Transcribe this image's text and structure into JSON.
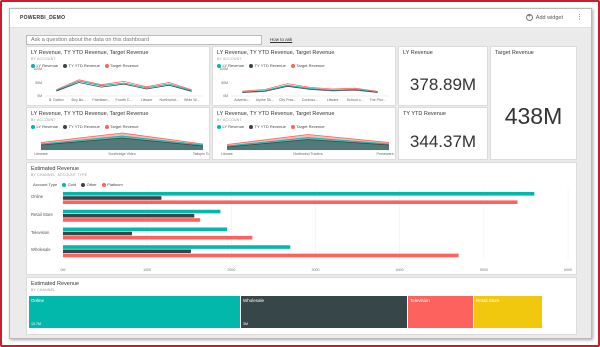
{
  "header": {
    "title": "POWERBI_DEMO",
    "add_widget": "Add widget",
    "more_icon": "more-options-icon"
  },
  "qna": {
    "placeholder": "Ask a question about the data on this dashboard",
    "howto": "How to ask"
  },
  "line_tiles": [
    {
      "title": "LY Revenue, TY YTD Revenue, Target Revenue",
      "subtitle": "BY ACCOUNT",
      "legend": [
        "LY Revenue",
        "TY YTD Revenue",
        "Target Revenue"
      ],
      "yticks": [
        "100M",
        "50M",
        "0M"
      ]
    },
    {
      "title": "LY Revenue, TY YTD Revenue, Target Revenue",
      "subtitle": "BY ACCOUNT",
      "legend": [
        "LY Revenue",
        "TY YTD Revenue",
        "Target Revenue"
      ],
      "yticks": [
        "100M",
        "50M",
        "0M"
      ]
    },
    {
      "title": "LY Revenue, TY YTD Revenue, Target Revenue",
      "subtitle": "BY ACCOUNT",
      "legend": [
        "LY Revenue",
        "TY YTD Revenue",
        "Target Revenue"
      ],
      "yticks": []
    },
    {
      "title": "LY Revenue, TY YTD Revenue, Target Revenue",
      "subtitle": "BY ACCOUNT",
      "legend": [
        "LY Revenue",
        "TY YTD Revenue",
        "Target Revenue"
      ],
      "yticks": []
    }
  ],
  "cards": {
    "ly_revenue": {
      "title": "LY Revenue",
      "value": "378.89M"
    },
    "target_revenue": {
      "title": "Target Revenue",
      "value": "438M"
    },
    "ty_ytd_revenue": {
      "title": "TY YTD Revenue",
      "value": "344.37M"
    }
  },
  "colors": {
    "ly": "#01b8aa",
    "ty": "#374649",
    "target": "#fd625e",
    "platinum": "#fd625e",
    "gold": "#01b8aa",
    "other": "#374649",
    "treemap_online": "#01b8aa",
    "treemap_wholesale": "#374649",
    "treemap_television": "#fd625e",
    "treemap_retail": "#f2c80f"
  },
  "chart_data": [
    {
      "type": "line",
      "categories": [
        "B. Dalton",
        "Buy Bu...",
        "Fabrikam...",
        "Fourth C...",
        "Litware",
        "Northwind...",
        "Wide W..."
      ],
      "series": [
        {
          "name": "LY Revenue",
          "values": [
            20,
            55,
            38,
            48,
            30,
            45,
            20
          ]
        },
        {
          "name": "TY YTD Revenue",
          "values": [
            18,
            50,
            33,
            44,
            26,
            40,
            17
          ]
        },
        {
          "name": "Target Revenue",
          "values": [
            23,
            60,
            42,
            54,
            34,
            50,
            23
          ]
        }
      ],
      "ylim": [
        0,
        100
      ]
    },
    {
      "type": "line",
      "categories": [
        "Adventu...",
        "Alpine Sk...",
        "City Pow...",
        "Contoso...",
        "Litware",
        "School o...",
        "The Pho..."
      ],
      "series": [
        {
          "name": "LY Revenue",
          "values": [
            15,
            20,
            40,
            28,
            22,
            25,
            15
          ]
        },
        {
          "name": "TY YTD Revenue",
          "values": [
            13,
            17,
            36,
            25,
            19,
            22,
            13
          ]
        },
        {
          "name": "Target Revenue",
          "values": [
            18,
            24,
            46,
            32,
            26,
            29,
            17
          ]
        }
      ],
      "ylim": [
        0,
        100
      ]
    },
    {
      "type": "area",
      "categories": [
        "Liteware",
        "Southridge Video",
        "Tailspin Toys"
      ],
      "series": [
        {
          "name": "LY Revenue",
          "values": [
            12,
            28,
            10
          ]
        },
        {
          "name": "TY YTD Revenue",
          "values": [
            10,
            24,
            8
          ]
        },
        {
          "name": "Target Revenue",
          "values": [
            15,
            34,
            12
          ]
        }
      ]
    },
    {
      "type": "area",
      "categories": [
        "Litware",
        "Northwind Traders",
        "Proseware, Inc."
      ],
      "series": [
        {
          "name": "LY Revenue",
          "values": [
            8,
            25,
            12
          ]
        },
        {
          "name": "TY YTD Revenue",
          "values": [
            6,
            21,
            10
          ]
        },
        {
          "name": "Target Revenue",
          "values": [
            11,
            31,
            15
          ]
        }
      ]
    },
    {
      "type": "bar",
      "title": "Estimated Revenue",
      "subtitle": "BY CHANNEL, ACCOUNT TYPE",
      "legend_title": "Account Type",
      "categories": [
        "Online",
        "Retail Store",
        "Television",
        "Wholesale"
      ],
      "series": [
        {
          "name": "Gold",
          "values": [
            5600,
            1870,
            1950,
            2700
          ]
        },
        {
          "name": "Other",
          "values": [
            1170,
            1560,
            820,
            1520
          ]
        },
        {
          "name": "Platinum",
          "values": [
            5400,
            1630,
            2250,
            4700
          ]
        }
      ],
      "xticks": [
        "0M",
        "1000",
        "2000",
        "3000",
        "4000",
        "5000",
        "6000"
      ],
      "xlim": [
        0,
        6000
      ]
    },
    {
      "type": "treemap",
      "title": "Estimated Revenue",
      "subtitle": "BY CHANNEL",
      "items": [
        {
          "name": "Online",
          "value": "13.7M"
        },
        {
          "name": "Wholesale",
          "value": "3M"
        },
        {
          "name": "Television",
          "value": ""
        },
        {
          "name": "Retail Store",
          "value": ""
        }
      ]
    }
  ]
}
